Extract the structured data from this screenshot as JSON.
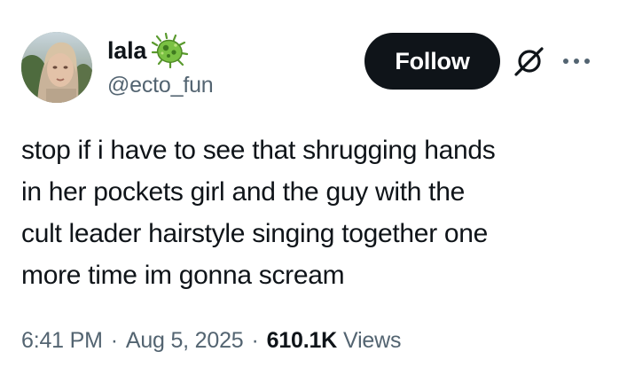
{
  "author": {
    "display_name": "lala",
    "handle": "@ecto_fun",
    "badge_icon": "microbe-emoji-icon",
    "avatar_icon": "profile-photo"
  },
  "actions": {
    "follow_label": "Follow",
    "grok_icon": "grok-icon",
    "more_icon": "more-options-icon"
  },
  "tweet": {
    "lines": [
      "stop if i have to see that shrugging hands",
      "in her pockets girl and the guy with the",
      "cult leader hairstyle singing together one",
      "more time im gonna scream"
    ]
  },
  "meta": {
    "time": "6:41 PM",
    "separator": "·",
    "date": "Aug 5, 2025",
    "views_count": "610.1K",
    "views_label": "Views"
  },
  "colors": {
    "text_primary": "#0f1419",
    "text_secondary": "#536471",
    "follow_bg": "#0f1419",
    "follow_text": "#ffffff",
    "badge_green": "#7ac143"
  }
}
